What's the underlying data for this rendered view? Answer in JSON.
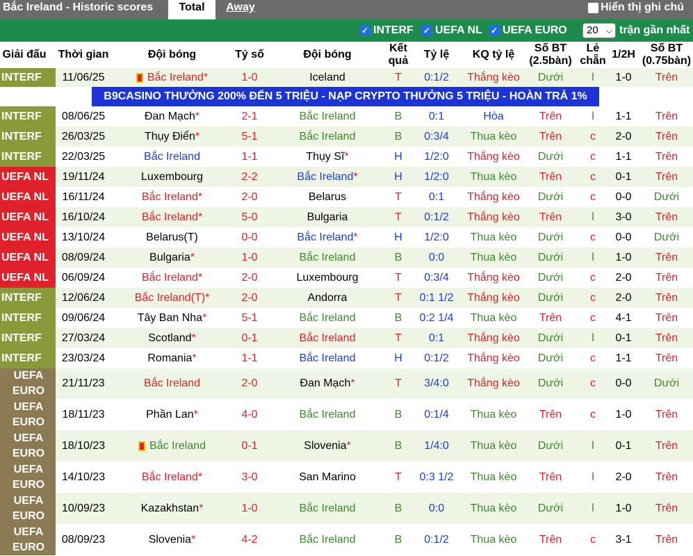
{
  "header": {
    "team_title": "Bắc Ireland - Historic scores",
    "tab_total": "Total",
    "tab_away": "Away",
    "note_toggle": "Hiển thị ghi chú"
  },
  "filters": {
    "interf": "INTERF",
    "uefa_nl": "UEFA NL",
    "uefa_euro": "UEFA EURO",
    "count": "20",
    "recent_label": "trận gần nhất"
  },
  "columns": {
    "competition": "Giải đấu",
    "time": "Thời gian",
    "home": "Đội bóng",
    "score": "Tỷ số",
    "away": "Đội bóng",
    "result": "Kết quả",
    "handicap": "Tỷ lệ",
    "handicap_result": "KQ tỷ lệ",
    "ou": "Số BT (2.5bàn)",
    "odd_even": "Lẻ chẵn",
    "half": "1/2H",
    "ou2": "Số BT (0.75bàn)"
  },
  "promo": "B9CASINO THƯỞNG 200% ĐẾN 5 TRIỆU - NẠP CRYPTO THƯỞNG 5 TRIỆU - HOÀN TRẢ 1%",
  "colors": {
    "interf": "#8a9a3a",
    "uefa_nl": "#e0212b",
    "uefa_euro": "#8c7a52",
    "filter_bar": "#1e8a4c",
    "promo": "#1a34d8"
  },
  "matches": [
    {
      "comp": "INTERF",
      "date": "11/06/25",
      "home": "Bắc Ireland",
      "home_star": "*",
      "home_flag": "flag-icon",
      "home_color": "red",
      "score": "1-0",
      "away": "Iceland",
      "away_star": "",
      "away_color": "black",
      "result": "T",
      "handicap": "0:1/2",
      "hres": "Thắng kèo",
      "ou": "Dưới",
      "oe": "l",
      "half": "1-0",
      "ou2": "Trên"
    },
    {
      "comp": "INTERF",
      "date": "08/06/25",
      "home": "Đan Mạch",
      "home_star": "*",
      "home_color": "black",
      "score": "2-1",
      "away": "Bắc Ireland",
      "away_star": "",
      "away_color": "green",
      "result": "B",
      "handicap": "0:1",
      "hres": "Hòa",
      "ou": "Trên",
      "oe": "l",
      "half": "1-1",
      "ou2": "Trên"
    },
    {
      "comp": "INTERF",
      "date": "26/03/25",
      "home": "Thụy Điển",
      "home_star": "*",
      "home_color": "black",
      "score": "5-1",
      "away": "Bắc Ireland",
      "away_star": "",
      "away_color": "green",
      "result": "B",
      "handicap": "0:3/4",
      "hres": "Thua kèo",
      "ou": "Trên",
      "oe": "c",
      "half": "2-0",
      "ou2": "Trên"
    },
    {
      "comp": "INTERF",
      "date": "22/03/25",
      "home": "Bắc Ireland",
      "home_star": "",
      "home_color": "blue",
      "score": "1-1",
      "away": "Thụy Sĩ",
      "away_star": "*",
      "away_color": "black",
      "result": "H",
      "handicap": "1/2:0",
      "hres": "Thắng kèo",
      "ou": "Dưới",
      "oe": "c",
      "half": "1-1",
      "ou2": "Trên"
    },
    {
      "comp": "UEFA NL",
      "date": "19/11/24",
      "home": "Luxembourg",
      "home_star": "",
      "home_color": "black",
      "score": "2-2",
      "away": "Bắc Ireland",
      "away_star": "*",
      "away_color": "blue",
      "result": "H",
      "handicap": "1/2:0",
      "hres": "Thua kèo",
      "ou": "Trên",
      "oe": "c",
      "half": "0-1",
      "ou2": "Trên"
    },
    {
      "comp": "UEFA NL",
      "date": "16/11/24",
      "home": "Bắc Ireland",
      "home_star": "*",
      "home_color": "red",
      "score": "2-0",
      "away": "Belarus",
      "away_star": "",
      "away_color": "black",
      "result": "T",
      "handicap": "0:1",
      "hres": "Thắng kèo",
      "ou": "Dưới",
      "oe": "c",
      "half": "0-0",
      "ou2": "Dưới"
    },
    {
      "comp": "UEFA NL",
      "date": "16/10/24",
      "home": "Bắc Ireland",
      "home_star": "*",
      "home_color": "red",
      "score": "5-0",
      "away": "Bulgaria",
      "away_star": "",
      "away_color": "black",
      "result": "T",
      "handicap": "0:1/2",
      "hres": "Thắng kèo",
      "ou": "Trên",
      "oe": "l",
      "half": "3-0",
      "ou2": "Trên"
    },
    {
      "comp": "UEFA NL",
      "date": "13/10/24",
      "home": "Belarus(T)",
      "home_star": "",
      "home_color": "black",
      "score": "0-0",
      "away": "Bắc Ireland",
      "away_star": "*",
      "away_color": "blue",
      "result": "H",
      "handicap": "1/2:0",
      "hres": "Thua kèo",
      "ou": "Dưới",
      "oe": "c",
      "half": "0-0",
      "ou2": "Dưới"
    },
    {
      "comp": "UEFA NL",
      "date": "08/09/24",
      "home": "Bulgaria",
      "home_star": "*",
      "home_color": "black",
      "score": "1-0",
      "away": "Bắc Ireland",
      "away_star": "",
      "away_color": "green",
      "result": "B",
      "handicap": "0:0",
      "hres": "Thua kèo",
      "ou": "Dưới",
      "oe": "l",
      "half": "1-0",
      "ou2": "Trên"
    },
    {
      "comp": "UEFA NL",
      "date": "06/09/24",
      "home": "Bắc Ireland",
      "home_star": "*",
      "home_color": "red",
      "score": "2-0",
      "away": "Luxembourg",
      "away_star": "",
      "away_color": "black",
      "result": "T",
      "handicap": "0:3/4",
      "hres": "Thắng kèo",
      "ou": "Dưới",
      "oe": "c",
      "half": "2-0",
      "ou2": "Trên"
    },
    {
      "comp": "INTERF",
      "date": "12/06/24",
      "home": "Bắc Ireland(T)",
      "home_star": "*",
      "home_color": "red",
      "score": "2-0",
      "away": "Andorra",
      "away_star": "",
      "away_color": "black",
      "result": "T",
      "handicap": "0:1 1/2",
      "hres": "Thắng kèo",
      "ou": "Dưới",
      "oe": "c",
      "half": "2-0",
      "ou2": "Trên"
    },
    {
      "comp": "INTERF",
      "date": "09/06/24",
      "home": "Tây Ban Nha",
      "home_star": "*",
      "home_color": "black",
      "score": "5-1",
      "away": "Bắc Ireland",
      "away_star": "",
      "away_color": "green",
      "result": "B",
      "handicap": "0:2 1/4",
      "hres": "Thua kèo",
      "ou": "Trên",
      "oe": "c",
      "half": "4-1",
      "ou2": "Trên"
    },
    {
      "comp": "INTERF",
      "date": "27/03/24",
      "home": "Scotland",
      "home_star": "*",
      "home_color": "black",
      "score": "0-1",
      "away": "Bắc Ireland",
      "away_star": "",
      "away_color": "red",
      "result": "T",
      "handicap": "0:1",
      "hres": "Thắng kèo",
      "ou": "Dưới",
      "oe": "l",
      "half": "0-1",
      "ou2": "Trên"
    },
    {
      "comp": "INTERF",
      "date": "23/03/24",
      "home": "Romania",
      "home_star": "*",
      "home_color": "black",
      "score": "1-1",
      "away": "Bắc Ireland",
      "away_star": "",
      "away_color": "blue",
      "result": "H",
      "handicap": "0:1/2",
      "hres": "Thắng kèo",
      "ou": "Dưới",
      "oe": "c",
      "half": "1-1",
      "ou2": "Trên"
    },
    {
      "comp": "UEFA EURO",
      "date": "21/11/23",
      "home": "Bắc Ireland",
      "home_star": "",
      "home_color": "red",
      "score": "2-0",
      "away": "Đan Mạch",
      "away_star": "*",
      "away_color": "black",
      "result": "T",
      "handicap": "3/4:0",
      "hres": "Thắng kèo",
      "ou": "Dưới",
      "oe": "c",
      "half": "0-0",
      "ou2": "Dưới"
    },
    {
      "comp": "UEFA EURO",
      "date": "18/11/23",
      "home": "Phần Lan",
      "home_star": "*",
      "home_color": "black",
      "score": "4-0",
      "away": "Bắc Ireland",
      "away_star": "",
      "away_color": "green",
      "result": "B",
      "handicap": "0:1/4",
      "hres": "Thua kèo",
      "ou": "Trên",
      "oe": "c",
      "half": "1-0",
      "ou2": "Trên"
    },
    {
      "comp": "UEFA EURO",
      "date": "18/10/23",
      "home": "Bắc Ireland",
      "home_star": "",
      "home_flag": "flag-icon",
      "home_color": "green",
      "score": "0-1",
      "away": "Slovenia",
      "away_star": "*",
      "away_color": "black",
      "result": "B",
      "handicap": "1/4:0",
      "hres": "Thua kèo",
      "ou": "Dưới",
      "oe": "l",
      "half": "0-1",
      "ou2": "Trên"
    },
    {
      "comp": "UEFA EURO",
      "date": "14/10/23",
      "home": "Bắc Ireland",
      "home_star": "*",
      "home_color": "red",
      "score": "3-0",
      "away": "San Marino",
      "away_star": "",
      "away_color": "black",
      "result": "T",
      "handicap": "0:3 1/2",
      "hres": "Thua kèo",
      "ou": "Trên",
      "oe": "l",
      "half": "2-0",
      "ou2": "Trên"
    },
    {
      "comp": "UEFA EURO",
      "date": "10/09/23",
      "home": "Kazakhstan",
      "home_star": "*",
      "home_color": "black",
      "score": "1-0",
      "away": "Bắc Ireland",
      "away_star": "",
      "away_color": "green",
      "result": "B",
      "handicap": "0:0",
      "hres": "Thua kèo",
      "ou": "Dưới",
      "oe": "l",
      "half": "1-0",
      "ou2": "Trên"
    },
    {
      "comp": "UEFA EURO",
      "date": "08/09/23",
      "home": "Slovenia",
      "home_star": "*",
      "home_color": "black",
      "score": "4-2",
      "away": "Bắc Ireland",
      "away_star": "",
      "away_color": "green",
      "result": "B",
      "handicap": "0:1/2",
      "hres": "Thua kèo",
      "ou": "Trên",
      "oe": "c",
      "half": "3-1",
      "ou2": "Trên"
    }
  ]
}
